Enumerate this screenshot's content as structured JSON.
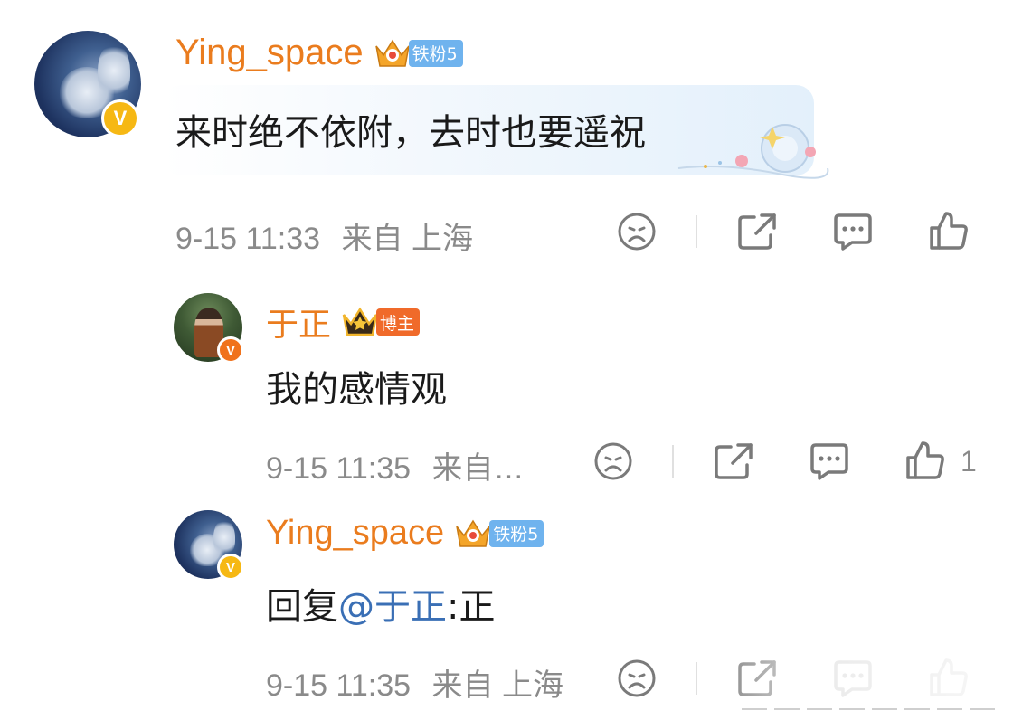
{
  "comments": [
    {
      "username": "Ying_space",
      "fan_tag": "铁粉5",
      "text": "来时绝不依附，去时也要遥祝",
      "time": "9-15 11:33",
      "location": "来自 上海"
    },
    {
      "username": "于正",
      "fan_tag": "博主",
      "text": "我的感情观",
      "time": "9-15 11:35",
      "location": "来自…",
      "like_count": "1"
    },
    {
      "username": "Ying_space",
      "fan_tag": "铁粉5",
      "reply_prefix": "回复",
      "mention": "@于正",
      "reply_suffix": ":正",
      "time": "9-15 11:35",
      "location": "来自 上海"
    }
  ],
  "colors": {
    "username": "#ea7c1e",
    "meta": "#8a8a8a",
    "mention": "#3a6fb5",
    "fan_tag_blue": "#6fb3ee",
    "fan_tag_red": "#f06a2a",
    "verified_gold": "#f6b814",
    "verified_orange": "#f0721c"
  },
  "icons": [
    "sad-face-icon",
    "share-icon",
    "comment-icon",
    "like-icon",
    "verified-v-icon",
    "crown-icon"
  ]
}
